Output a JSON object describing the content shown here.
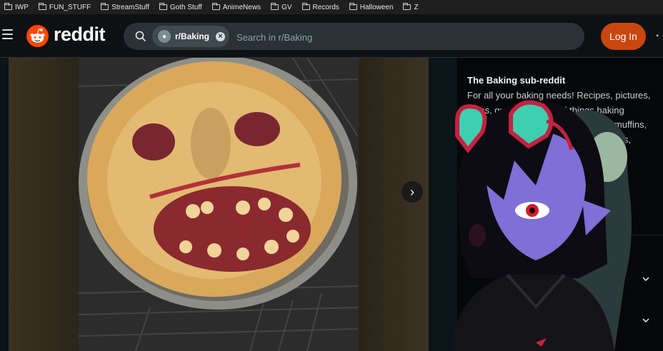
{
  "bookmarks": [
    {
      "label": "IWP",
      "icon": "folder-icon"
    },
    {
      "label": "FUN_STUFF",
      "icon": "folder-icon"
    },
    {
      "label": "StreamStuff",
      "icon": "folder-icon"
    },
    {
      "label": "Goth Stuff",
      "icon": "folder-icon"
    },
    {
      "label": "AnimeNews",
      "icon": "folder-icon"
    },
    {
      "label": "GV",
      "icon": "folder-icon"
    },
    {
      "label": "Records",
      "icon": "folder-icon"
    },
    {
      "label": "Halloween",
      "icon": "folder-icon"
    },
    {
      "label": "Z",
      "icon": "folder-icon"
    }
  ],
  "header": {
    "brand": "reddit",
    "search": {
      "chip_label": "r/Baking",
      "placeholder": "Search in r/Baking"
    },
    "login_label": "Log In"
  },
  "sidebar": {
    "title": "The Baking sub-reddit",
    "description": "For all your baking needs! Recipes, pictures, ideas, questions, and all things baking related. Cakes, cookies, pies, tarts, muffins, breads, doughs, pastries, cheesecakes,"
  },
  "colors": {
    "accent": "#c9460f",
    "brand_orange": "#ff4500",
    "background": "#0b1416"
  }
}
